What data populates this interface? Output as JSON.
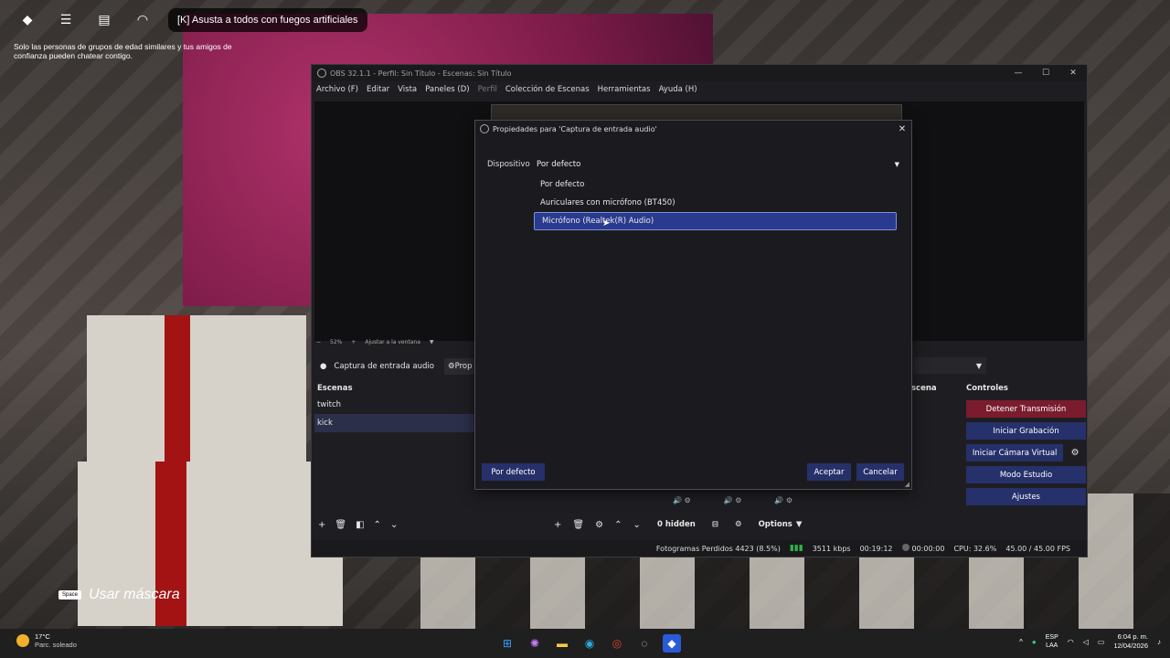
{
  "roblox": {
    "top_chip_text": "[K] Asusta a todos con fuegos artificiales",
    "chat_notice": "Solo las personas de grupos de edad similares y tus amigos de confianza pueden chatear contigo.",
    "mask_key": "Space",
    "mask_label": "Usar máscara"
  },
  "obs": {
    "title": "OBS 32.1.1 - Perfil: Sin Título - Escenas: Sin Título",
    "menu": [
      "Archivo (F)",
      "Editar",
      "Vista",
      "Paneles (D)",
      "Perfil",
      "Colección de Escenas",
      "Herramientas",
      "Ayuda (H)"
    ],
    "zoom": "52%",
    "fit_label": "Ajustar a la ventana",
    "source_name": "Captura de entrada audio",
    "props_short": "Prop",
    "scenes": {
      "title": "Escenas",
      "items": [
        "twitch",
        "kick"
      ],
      "selected": "kick"
    },
    "transition_title": "scena",
    "mixer_hidden": "0 hidden",
    "options_label": "Options",
    "controls": {
      "title": "Controles",
      "stop_stream": "Detener Transmisión",
      "start_recording": "Iniciar Grabación",
      "virtual_cam": "Iniciar Cámara Virtual",
      "studio_mode": "Modo Estudio",
      "settings": "Ajustes"
    },
    "status": {
      "dropped": "Fotogramas Perdidos 4423 (8.5%)",
      "bitrate": "3511 kbps",
      "stream_time": "00:19:12",
      "rec_time": "00:00:00",
      "cpu": "CPU: 32.6%",
      "fps": "45.00 / 45.00 FPS"
    }
  },
  "dialog": {
    "title": "Propiedades para 'Captura de entrada audio'",
    "field_label": "Dispositivo",
    "selected_value": "Por defecto",
    "options": [
      "Por defecto",
      "Auriculares con micrófono (BT450)",
      "Micrófono (Realtek(R) Audio)"
    ],
    "highlighted_index": 2,
    "defaults_button": "Por defecto",
    "ok_button": "Aceptar",
    "cancel_button": "Cancelar"
  },
  "taskbar": {
    "temperature": "17°C",
    "weather_desc": "Parc. soleado",
    "lang_1": "ESP",
    "lang_2": "LAA",
    "time": "6:04 p. m.",
    "date": "12/04/2026"
  },
  "colors": {
    "accent_blue": "#26306a",
    "stop_red": "#7a1c2e",
    "highlight": "#2a3a8e"
  }
}
